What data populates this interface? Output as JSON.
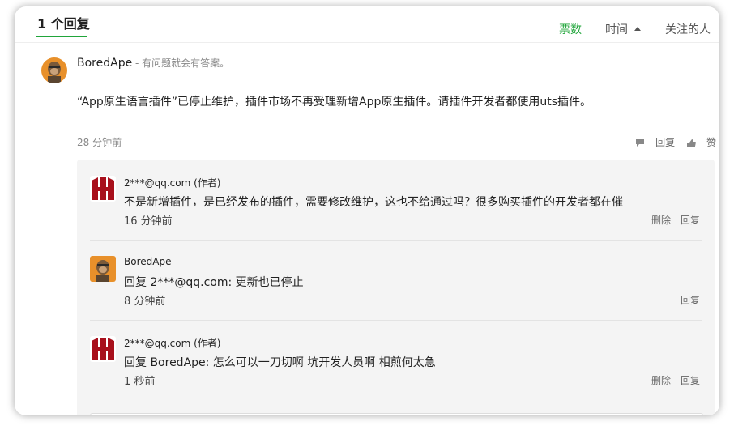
{
  "header": {
    "reply_count": "1 个回复",
    "sort_votes": "票数",
    "sort_time": "时间",
    "sort_followers": "关注的人"
  },
  "main_reply": {
    "author": "BoredApe",
    "separator": " - ",
    "tagline": "有问题就会有答案。",
    "content": "“App原生语言插件”已停止维护，插件市场不再受理新增App原生插件。请插件开发者都使用uts插件。",
    "time": "28 分钟前",
    "reply_label": "回复",
    "like_label": "赞"
  },
  "comments": [
    {
      "author": "2***@qq.com (作者)",
      "text": "不是新增插件，是已经发布的插件，需要修改维护，这也不给通过吗？很多购买插件的开发者都在催",
      "time": "16 分钟前",
      "delete_label": "删除",
      "reply_label": "回复"
    },
    {
      "author": "BoredApe",
      "text": "回复 2***@qq.com: 更新也已停止",
      "time": "8 分钟前",
      "reply_label": "回复"
    },
    {
      "author": "2***@qq.com (作者)",
      "text": "回复 BoredApe: 怎么可以一刀切啊 坑开发人员啊 相煎何太急",
      "time": "1 秒前",
      "delete_label": "删除",
      "reply_label": "回复"
    }
  ],
  "colors": {
    "accent": "#20a53a",
    "author_avatar": "#a8101c",
    "ape_bg": "#e8902a"
  }
}
